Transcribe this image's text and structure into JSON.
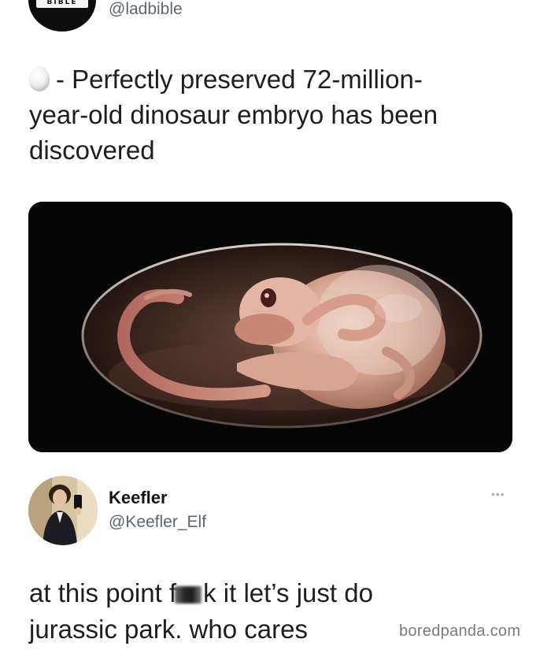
{
  "top_tweet": {
    "avatar_label": "BIBLE",
    "handle": "@ladbible",
    "emoji_icon": "egg-icon",
    "text_part1": "- Perfectly preserved 72-million-",
    "text_part2": "year-old dinosaur embryo has been",
    "text_part3": "discovered",
    "media_icon": "dinosaur-embryo-in-egg-image"
  },
  "reply_tweet": {
    "avatar_icon": "person-selfie-avatar",
    "name": "Keefler",
    "handle": "@Keefler_Elf",
    "more_icon": "more-options-icon",
    "text_line1_a": "at this point f",
    "text_line1_b": "k it let’s just do",
    "text_line2": "jurassic park. who cares"
  },
  "watermark": "boredpanda.com",
  "colors": {
    "background": "#ffffff",
    "handle_gray": "#5b6670",
    "text": "#1e1e1e",
    "media_bg": "#050505"
  }
}
